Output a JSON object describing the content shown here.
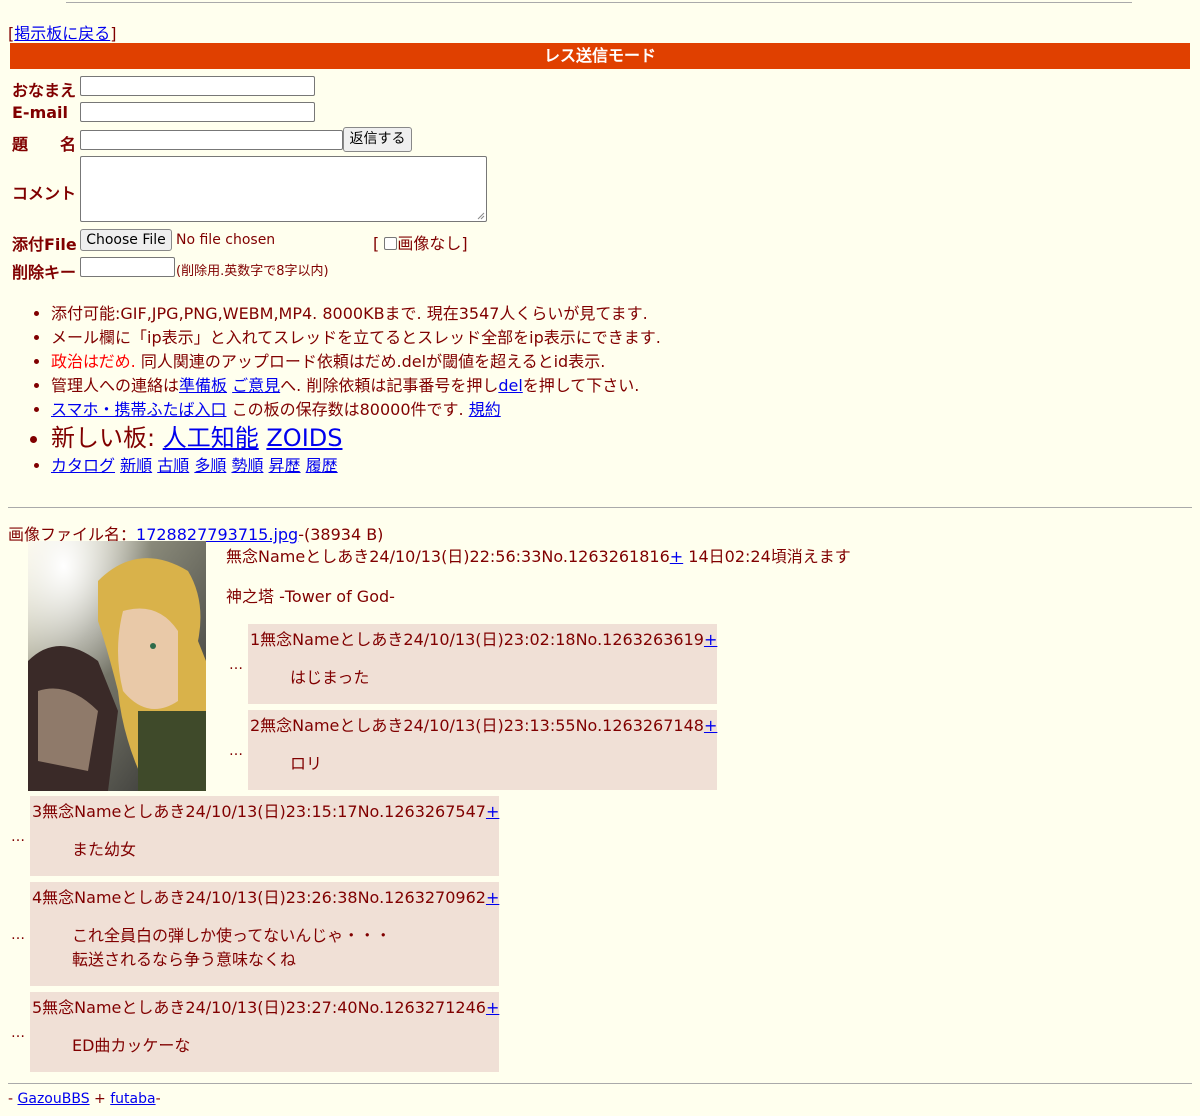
{
  "nav": {
    "bracket_open": "[",
    "back_link": "掲示板に戻る",
    "bracket_close": "]"
  },
  "mode_bar": {
    "title": "レス送信モード"
  },
  "form": {
    "name_label": "おなまえ",
    "email_label": "E-mail",
    "subject_label": "題　　名",
    "submit_label": "返信する",
    "comment_label": "コメント",
    "file_label": "添付File",
    "choose_file_label": "Choose File",
    "no_file_text": "No file chosen",
    "no_image_open": "[",
    "no_image_label": "画像なし]",
    "delkey_label": "削除キー",
    "delkey_note": "(削除用.英数字で8字以内)"
  },
  "notes": {
    "line1": "添付可能:GIF,JPG,PNG,WEBM,MP4. 8000KBまで. 現在3547人くらいが見てます.",
    "line2": "メール欄に「ip表示」と入れてスレッドを立てるとスレッド全部をip表示にできます.",
    "line3_red": "政治はだめ.",
    "line3_rest": " 同人関連のアップロード依頼はだめ.delが閾値を超えるとid表示.",
    "line4_pre": "管理人への連絡は",
    "line4_link1": "準備板",
    "line4_space": " ",
    "line4_link2": "ご意見",
    "line4_mid": "へ. 削除依頼は記事番号を押し",
    "line4_link3": "del",
    "line4_post": "を押して下さい.",
    "line5_link": "スマホ・携帯ふたば入口",
    "line5_mid": " この板の保存数は80000件です. ",
    "line5_link2": "規約",
    "line6_pre": "新しい板: ",
    "line6_link1": "人工知能",
    "line6_link2": "ZOIDS",
    "line7_links": [
      "カタログ",
      "新順",
      "古順",
      "多順",
      "勢順",
      "昇歴",
      "履歴"
    ]
  },
  "thread": {
    "file_label": "画像ファイル名：",
    "file_name": "1728827793715.jpg",
    "file_size": "-(38934 B)",
    "op_header": "無念Nameとしあき24/10/13(日)22:56:33No.1263261816",
    "op_plus": "+",
    "op_expire": " 14日02:24頃消えます",
    "op_body": "神之塔 -Tower of God-",
    "replies": [
      {
        "header": "1無念Nameとしあき24/10/13(日)23:02:18No.1263263619",
        "plus": "+",
        "body1": "はじまった",
        "body2": ""
      },
      {
        "header": "2無念Nameとしあき24/10/13(日)23:13:55No.1263267148",
        "plus": "+",
        "body1": "ロリ",
        "body2": ""
      },
      {
        "header": "3無念Nameとしあき24/10/13(日)23:15:17No.1263267547",
        "plus": "+",
        "body1": "また幼女",
        "body2": ""
      },
      {
        "header": "4無念Nameとしあき24/10/13(日)23:26:38No.1263270962",
        "plus": "+",
        "body1": "これ全員白の弾しか使ってないんじゃ・・・",
        "body2": "転送されるなら争う意味なくね"
      },
      {
        "header": "5無念Nameとしあき24/10/13(日)23:27:40No.1263271246",
        "plus": "+",
        "body1": "ED曲カッケーな",
        "body2": ""
      }
    ],
    "dots": "…"
  },
  "footer": {
    "pre": "- ",
    "link1": "GazouBBS",
    "mid": " + ",
    "link2": "futaba",
    "post": "-"
  },
  "colors": {
    "background": "#ffffee",
    "text": "#800000",
    "mode_bar": "#e04000",
    "reply_bg": "#f0e0d6",
    "link": "#0000ee"
  }
}
